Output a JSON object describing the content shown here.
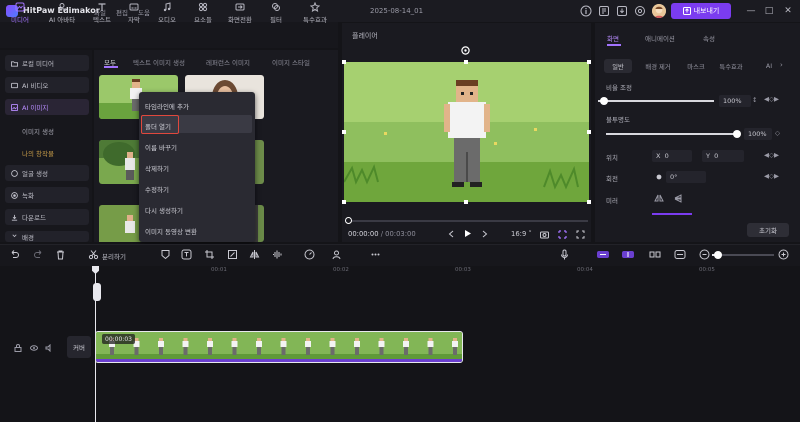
{
  "app": {
    "title": "HitPaw Edimakor",
    "menu": [
      "파일",
      "편집",
      "도움"
    ],
    "project_name": "2025-08-14_01",
    "export_label": "내보내기",
    "accent": "#7b3cf0"
  },
  "toolbar": {
    "tools": [
      {
        "label": "미디어",
        "icon": "media-icon",
        "active": true
      },
      {
        "label": "AI 아바타",
        "icon": "ai-avatar-icon"
      },
      {
        "label": "텍스트",
        "icon": "text-icon"
      },
      {
        "label": "자막",
        "icon": "subtitle-icon"
      },
      {
        "label": "오디오",
        "icon": "audio-icon"
      },
      {
        "label": "요소들",
        "icon": "elements-icon"
      },
      {
        "label": "화면전환",
        "icon": "transition-icon"
      },
      {
        "label": "필터",
        "icon": "filter-icon"
      },
      {
        "label": "특수효과",
        "icon": "effects-icon"
      }
    ]
  },
  "sidebar": {
    "items": [
      {
        "label": "로컬 미디어",
        "icon": "folder-icon"
      },
      {
        "label": "AI 비디오",
        "icon": "ai-video-icon"
      },
      {
        "label": "AI 이미지",
        "icon": "ai-image-icon",
        "active": true
      }
    ],
    "subitems": [
      {
        "label": "이미지 생성"
      },
      {
        "label": "나의 창작물",
        "active": true
      }
    ],
    "items2": [
      {
        "label": "얼굴 생성",
        "icon": "face-icon"
      },
      {
        "label": "녹화",
        "icon": "record-icon"
      },
      {
        "label": "다운로드",
        "icon": "download-icon"
      },
      {
        "label": "배경",
        "icon": "background-icon"
      }
    ]
  },
  "media_panel": {
    "tabs": [
      "모두",
      "텍스트 이미지 생성",
      "레퍼런스 이미지",
      "이미지 스타일"
    ]
  },
  "context_menu": {
    "items": [
      "타임라인에 추가",
      "폴더 열기",
      "이름 바꾸기",
      "삭제하기",
      "수정하기",
      "다시 생성하기",
      "이미지 동영상 변환"
    ]
  },
  "player": {
    "title": "플레이어",
    "current_time": "00:00:00",
    "total_time": "00:03:00",
    "aspect_ratio": "16:9"
  },
  "properties": {
    "tabs": [
      "화면",
      "애니메이션",
      "속성"
    ],
    "sub_tabs": [
      "일반",
      "배경 제거",
      "마스크",
      "특수효과",
      "AI"
    ],
    "scale_label": "비율 조정",
    "scale_value": "100%",
    "scale_level": 0.05,
    "opacity_label": "불투명도",
    "opacity_value": "100%",
    "opacity_level": 1.0,
    "position_label": "위치",
    "pos_x_label": "X",
    "pos_x": "0",
    "pos_y_label": "Y",
    "pos_y": "0",
    "rotate_label": "회전",
    "rotate_value": "0°",
    "mirror_label": "미러",
    "reset_label": "초기화"
  },
  "timeline": {
    "split_label": "분리하기",
    "ticks": [
      "00:01",
      "00:02",
      "00:03",
      "00:04",
      "00:05"
    ],
    "track_name": "커버",
    "clip_label": "00:00:03"
  }
}
